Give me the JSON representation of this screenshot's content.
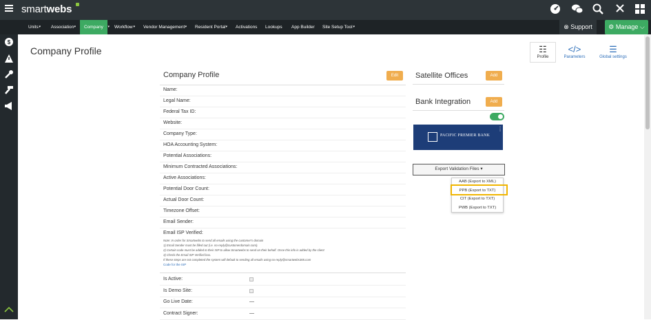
{
  "app": {
    "logo_prefix": "smart",
    "logo_suffix": "webs"
  },
  "topbar_icons": [
    "dashboard-icon",
    "chat-icon",
    "search-icon",
    "close-icon",
    "apps-icon"
  ],
  "sidebar_icons": [
    "hamburger-icon",
    "dashboard-icon",
    "dollar-icon",
    "alert-icon",
    "wrench-icon",
    "hammer-icon",
    "megaphone-icon"
  ],
  "nav": {
    "items": [
      "Units",
      "Association",
      "Company",
      "Workflow",
      "Vendor Management",
      "Resident Portal",
      "Activations",
      "Lookups",
      "App Builder",
      "Site Setup Tool"
    ],
    "dropdown_flags": [
      true,
      true,
      true,
      true,
      true,
      true,
      false,
      false,
      false,
      true
    ],
    "active": "Company",
    "support": "Support",
    "manage": "Manage",
    "caret": "▾"
  },
  "page": {
    "title": "Company Profile"
  },
  "toolbar": {
    "profile": "Profile",
    "parameters": "Parameters",
    "global": "Global settings"
  },
  "profile": {
    "heading": "Company Profile",
    "edit": "Edit",
    "fields": [
      "Name:",
      "Legal Name:",
      "Federal Tax ID:",
      "Website:",
      "Company Type:",
      "HOA Accounting System:",
      "Potential Associations:",
      "Minimum Contracted Associations:",
      "Active Associations:",
      "Potential Door Count:",
      "Actual Door Count:",
      "Timezone Offset:",
      "Email Sender:",
      "Email ISP Verified:"
    ],
    "note_lines": [
      "Note: In order for Smartwebs to send all emails using the customer's domain",
      "1) Email Sender must be filled out (i.e. no-reply@customerdomain.com).",
      "2) Certain code must be added to their ISP to allow Smartwebs to send on their behalf. Once this info is added by the client",
      "3) Check the Email ISP Verified box.",
      "If these steps are not completed the system will default to sending all emails using no-reply@smartwebs365.com"
    ],
    "code_link": "Code for the ISP",
    "lower_fields": [
      {
        "label": "Is Active:",
        "value": "",
        "checkbox": true
      },
      {
        "label": "Is Demo Site:",
        "value": "",
        "checkbox": true
      },
      {
        "label": "Go Live Date:",
        "value": "—",
        "checkbox": false
      },
      {
        "label": "Contract Signer:",
        "value": "—",
        "checkbox": false
      }
    ]
  },
  "satellite": {
    "title": "Satellite Offices",
    "add": "Add"
  },
  "bank": {
    "title": "Bank Integration",
    "add": "Add",
    "card_name": "PACIFIC PREMIER BANK",
    "menu": "⋮"
  },
  "export": {
    "button": "Export Validation Files",
    "items": [
      "AAB (Export to XML)",
      "PPB (Export to TXT)",
      "CIT (Export to TXT)",
      "PWB (Export to TXT)"
    ],
    "highlighted": "PPB (Export to TXT)"
  },
  "colors": {
    "topbar": "#2d3438",
    "green": "#3daa62",
    "orange": "#f0ad4e",
    "bank_blue": "#1d3d78",
    "highlight": "#f0b400"
  }
}
